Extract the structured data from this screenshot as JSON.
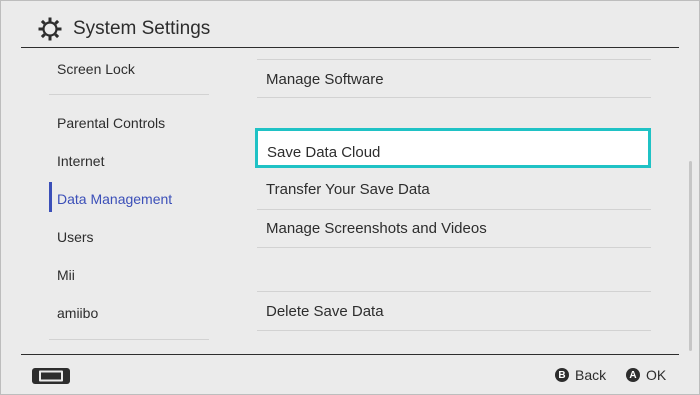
{
  "header": {
    "title": "System Settings",
    "icon": "gear-icon"
  },
  "sidebar": {
    "items": [
      {
        "label": "Screen Lock"
      },
      {
        "label": "Parental Controls"
      },
      {
        "label": "Internet"
      },
      {
        "label": "Data Management",
        "active": true
      },
      {
        "label": "Users"
      },
      {
        "label": "Mii"
      },
      {
        "label": "amiibo"
      }
    ]
  },
  "main": {
    "rows": [
      {
        "label": "Manage Software"
      },
      {
        "label": "Save Data Cloud",
        "selected": true
      },
      {
        "label": "Transfer Your Save Data"
      },
      {
        "label": "Manage Screenshots and Videos"
      },
      {
        "label": "Delete Save Data"
      }
    ]
  },
  "footer": {
    "buttons": [
      {
        "glyph": "B",
        "label": "Back"
      },
      {
        "glyph": "A",
        "label": "OK"
      }
    ]
  },
  "colors": {
    "accent": "#3b4fb8",
    "selection": "#1fc2c5",
    "background": "#ebebeb"
  }
}
